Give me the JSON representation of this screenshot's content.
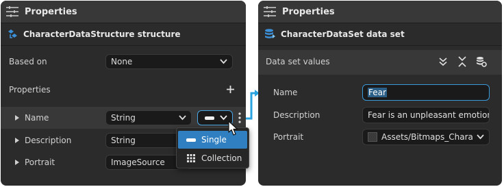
{
  "left_panel": {
    "title": "Properties",
    "subheader": "CharacterDataStructure structure",
    "based_on_label": "Based on",
    "based_on_value": "None",
    "properties_label": "Properties",
    "add_icon": "plus-icon",
    "rows": [
      {
        "name": "Name",
        "type": "String"
      },
      {
        "name": "Description",
        "type": "String"
      },
      {
        "name": "Portrait",
        "type": "ImageSource"
      }
    ],
    "collection_menu": {
      "items": [
        {
          "label": "Single",
          "icon": "single-value-icon",
          "active": true
        },
        {
          "label": "Collection",
          "icon": "grid-icon",
          "active": false
        }
      ]
    }
  },
  "right_panel": {
    "title": "Properties",
    "subheader": "CharacterDataSet data set",
    "section_label": "Data set values",
    "fields": [
      {
        "label": "Name",
        "value": "Fear"
      },
      {
        "label": "Description",
        "value": "Fear is an unpleasant emotion"
      },
      {
        "label": "Portrait",
        "value": "Assets/Bitmaps_Characters"
      }
    ]
  },
  "colors": {
    "panel_bg": "#2b2b2b",
    "header_bg": "#383838",
    "accent": "#2f7fc1",
    "connector": "#29a3e0"
  }
}
